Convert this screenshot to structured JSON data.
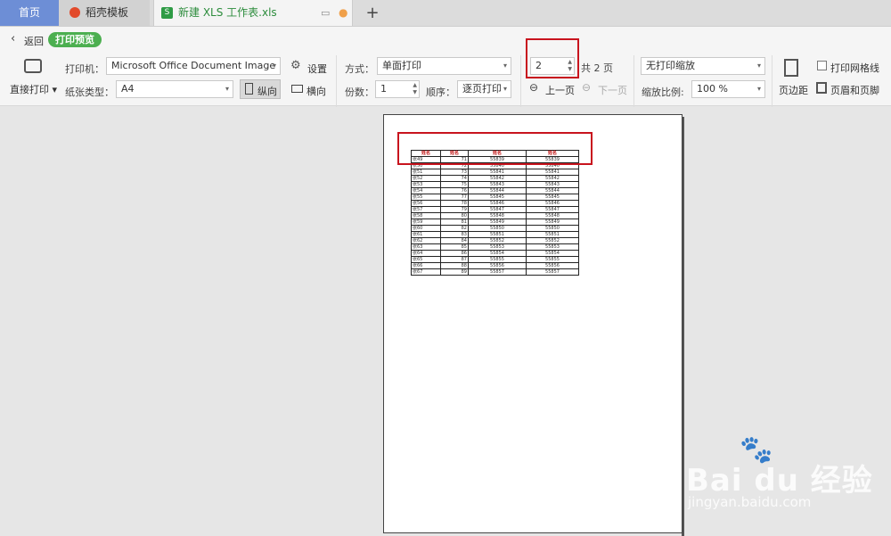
{
  "tabs": {
    "home": "首页",
    "template": "稻壳模板",
    "document": "新建 XLS 工作表.xls",
    "add": "+"
  },
  "header": {
    "back": "返回",
    "mode_badge": "打印预览"
  },
  "print": {
    "direct_print": "直接打印",
    "printer_label": "打印机：",
    "printer_value": "Microsoft Office Document Image",
    "settings": "设置",
    "paper_label": "纸张类型：",
    "paper_value": "A4",
    "portrait": "纵向",
    "landscape": "横向",
    "method_label": "方式：",
    "method_value": "单面打印",
    "copies_label": "份数：",
    "copies_value": "1",
    "order_label": "顺序：",
    "order_value": "逐页打印",
    "page_value": "2",
    "total_pages": "共 2 页",
    "prev_page": "上一页",
    "next_page": "下一页",
    "scaling_value": "无打印缩放",
    "zoom_label": "缩放比例:",
    "zoom_value": "100 %",
    "margins": "页边距",
    "gridlines": "打印网格线",
    "header_footer": "页眉和页脚"
  },
  "preview": {
    "headers": [
      "姓名",
      "姓名",
      "姓名",
      "姓名"
    ],
    "rows": [
      [
        "张49",
        "71",
        "55839",
        "55839"
      ],
      [
        "张50",
        "72",
        "55840",
        "55840"
      ],
      [
        "张51",
        "73",
        "55841",
        "55841"
      ],
      [
        "张52",
        "74",
        "55842",
        "55842"
      ],
      [
        "张53",
        "75",
        "55843",
        "55843"
      ],
      [
        "张54",
        "76",
        "55844",
        "55844"
      ],
      [
        "张55",
        "77",
        "55845",
        "55845"
      ],
      [
        "张56",
        "78",
        "55846",
        "55846"
      ],
      [
        "张57",
        "79",
        "55847",
        "55847"
      ],
      [
        "张58",
        "80",
        "55848",
        "55848"
      ],
      [
        "张59",
        "81",
        "55849",
        "55849"
      ],
      [
        "张60",
        "82",
        "55850",
        "55850"
      ],
      [
        "张61",
        "83",
        "55851",
        "55851"
      ],
      [
        "张62",
        "84",
        "55852",
        "55852"
      ],
      [
        "张63",
        "85",
        "55853",
        "55853"
      ],
      [
        "张64",
        "86",
        "55854",
        "55854"
      ],
      [
        "张65",
        "87",
        "55855",
        "55855"
      ],
      [
        "张66",
        "88",
        "55856",
        "55856"
      ],
      [
        "张67",
        "89",
        "55857",
        "55857"
      ]
    ]
  },
  "watermark": {
    "brand": "Bai du 经验",
    "url": "jingyan.baidu.com"
  },
  "colors": {
    "accent_green": "#4caf50",
    "highlight_red": "#c8141e",
    "tab_blue": "#6d8ed6"
  }
}
